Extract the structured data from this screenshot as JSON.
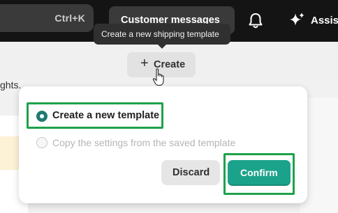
{
  "topbar": {
    "search_shortcut": "Ctrl+K",
    "customer_messages_label": "Customer messages",
    "assist_label": "Assist"
  },
  "page": {
    "partial_text": "ghts."
  },
  "tooltip": {
    "text": "Create a new shipping template"
  },
  "create_button": {
    "label": "Create"
  },
  "popover": {
    "options": [
      {
        "label": "Create a new template",
        "selected": true,
        "disabled": false
      },
      {
        "label": "Copy the settings from the saved template",
        "selected": false,
        "disabled": true
      }
    ],
    "discard_label": "Discard",
    "confirm_label": "Confirm"
  },
  "colors": {
    "topbar_bg": "#141414",
    "accent_confirm": "#1aa38a",
    "radio_selected": "#1f7a72",
    "highlight_box": "#1ea14b"
  },
  "icons": {
    "bell": "bell-icon",
    "sparkle": "sparkle-icon",
    "plus": "plus-icon",
    "cursor": "hand-pointer-cursor-icon"
  }
}
